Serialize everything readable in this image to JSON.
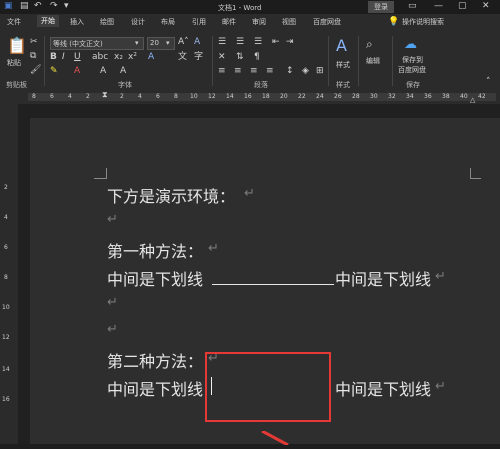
{
  "title_bar": {
    "document_title": "文档1 - Word",
    "login_label": "登录"
  },
  "tabs": [
    {
      "label": "文件"
    },
    {
      "label": "开始"
    },
    {
      "label": "插入"
    },
    {
      "label": "绘图"
    },
    {
      "label": "设计"
    },
    {
      "label": "布局"
    },
    {
      "label": "引用"
    },
    {
      "label": "邮件"
    },
    {
      "label": "审阅"
    },
    {
      "label": "视图"
    },
    {
      "label": "百度网盘"
    }
  ],
  "tell_me": "操作说明搜索",
  "ribbon": {
    "paste_label": "粘贴",
    "clipboard_group": "剪贴板",
    "font_name": "等线 (中文正文)",
    "font_size": "20",
    "font_group": "字体",
    "paragraph_group": "段落",
    "styles_label": "样式",
    "styles_group": "样式",
    "editing_label": "编辑",
    "save_to_label_1": "保存到",
    "save_to_label_2": "百度网盘",
    "save_group": "保存"
  },
  "ruler": {
    "ticks": [
      "8",
      "6",
      "4",
      "2",
      "2",
      "4",
      "6",
      "8",
      "10",
      "12",
      "14",
      "16",
      "18",
      "20",
      "22",
      "24",
      "26",
      "28",
      "30",
      "32",
      "34",
      "36",
      "38",
      "40",
      "42"
    ],
    "v_ticks": [
      "2",
      "4",
      "6",
      "8",
      "10",
      "12",
      "14",
      "16"
    ]
  },
  "document": {
    "line1": "下方是演示环境：",
    "line3": "第一种方法：",
    "line4_a": "中间是下划线",
    "line4_b": "中间是下划线",
    "line7": "第二种方法：",
    "line8_a": "中间是下划线",
    "line8_b": "中间是下划线",
    "paragraph_mark": "↵"
  },
  "colors": {
    "annotation": "#e53935",
    "background": "#2e2e2e"
  }
}
